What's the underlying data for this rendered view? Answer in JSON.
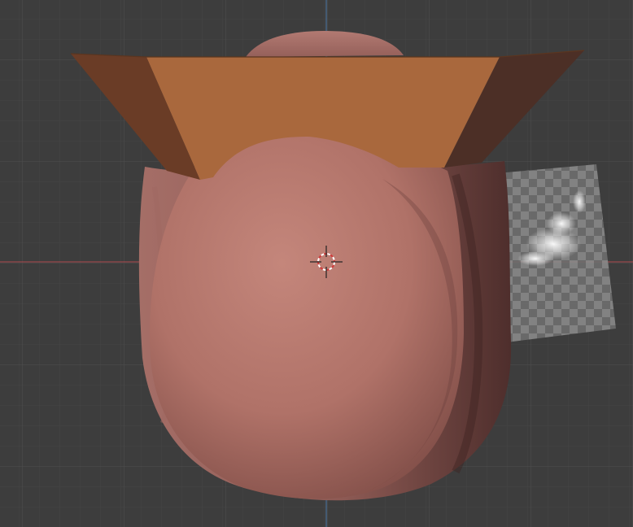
{
  "viewport": {
    "mode": "3d-viewport",
    "background_color": "#3d3d3d",
    "grid_minor_color": "#444444",
    "grid_major_color": "#4d4d4d",
    "x_axis_color": "#b04a4e",
    "y_axis_color": "#4a78a8"
  },
  "objects": {
    "head_mesh": {
      "color": "#b97b72"
    },
    "neck_cloth": {
      "color": "#6a3a35"
    },
    "hat_brim": {
      "color": "#a9683d"
    },
    "hat_crown": {
      "color": "#a7675f"
    },
    "reference_image": {
      "icon": "smoke-image-icon",
      "pattern": "checkerboard-transparency"
    }
  },
  "cursor": {
    "icon": "3d-cursor-icon"
  }
}
